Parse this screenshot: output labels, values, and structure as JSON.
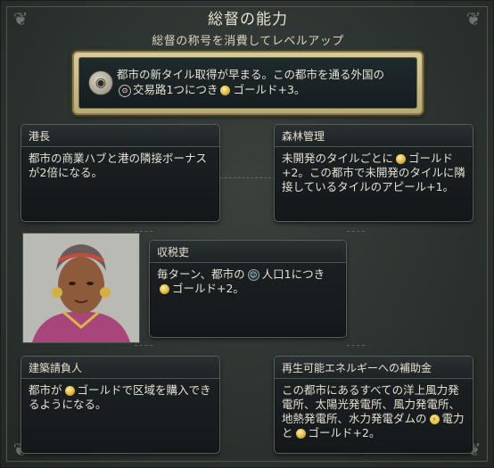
{
  "header": {
    "title": "総督の能力",
    "subtitle": "総督の称号を消費してレベルアップ"
  },
  "featured_ability": {
    "icon": "governor-seal-icon",
    "text_part1": "都市の新タイル取得が早まる。この都市を通る外国の",
    "text_trade": "交易路1つにつき",
    "text_gold": "ゴールド+3。"
  },
  "cards": {
    "harbormaster": {
      "title": "港長",
      "text": "都市の商業ハブと港の隣接ボーナスが2倍になる。"
    },
    "forestry": {
      "title": "森林管理",
      "text_a": "未開発のタイルごとに",
      "text_b": "ゴールド+2。この都市で未開発のタイルに隣接しているタイルのアピール+1。"
    },
    "tax_collector": {
      "title": "収税吏",
      "text_a": "毎ターン、都市の",
      "text_b": "人口1につき",
      "text_c": "ゴールド+2。"
    },
    "contractor": {
      "title": "建築請負人",
      "text_a": "都市が",
      "text_b": "ゴールドで区域を購入できるようになる。"
    },
    "renewable": {
      "title": "再生可能エネルギーへの補助金",
      "text_a": "この都市にあるすべての洋上風力発電所、太陽光発電所、風力発電所、地熱発電所、水力発電ダムの",
      "text_b": "電力と",
      "text_c": "ゴールド+2。"
    }
  },
  "icons": {
    "gold": "gold-icon",
    "trade_route": "trade-route-icon",
    "citizen": "citizen-icon",
    "power": "power-icon"
  },
  "colors": {
    "featured_border": "#b9aa76",
    "card_bg": "#1a1f21",
    "text": "#e4e0d2"
  }
}
